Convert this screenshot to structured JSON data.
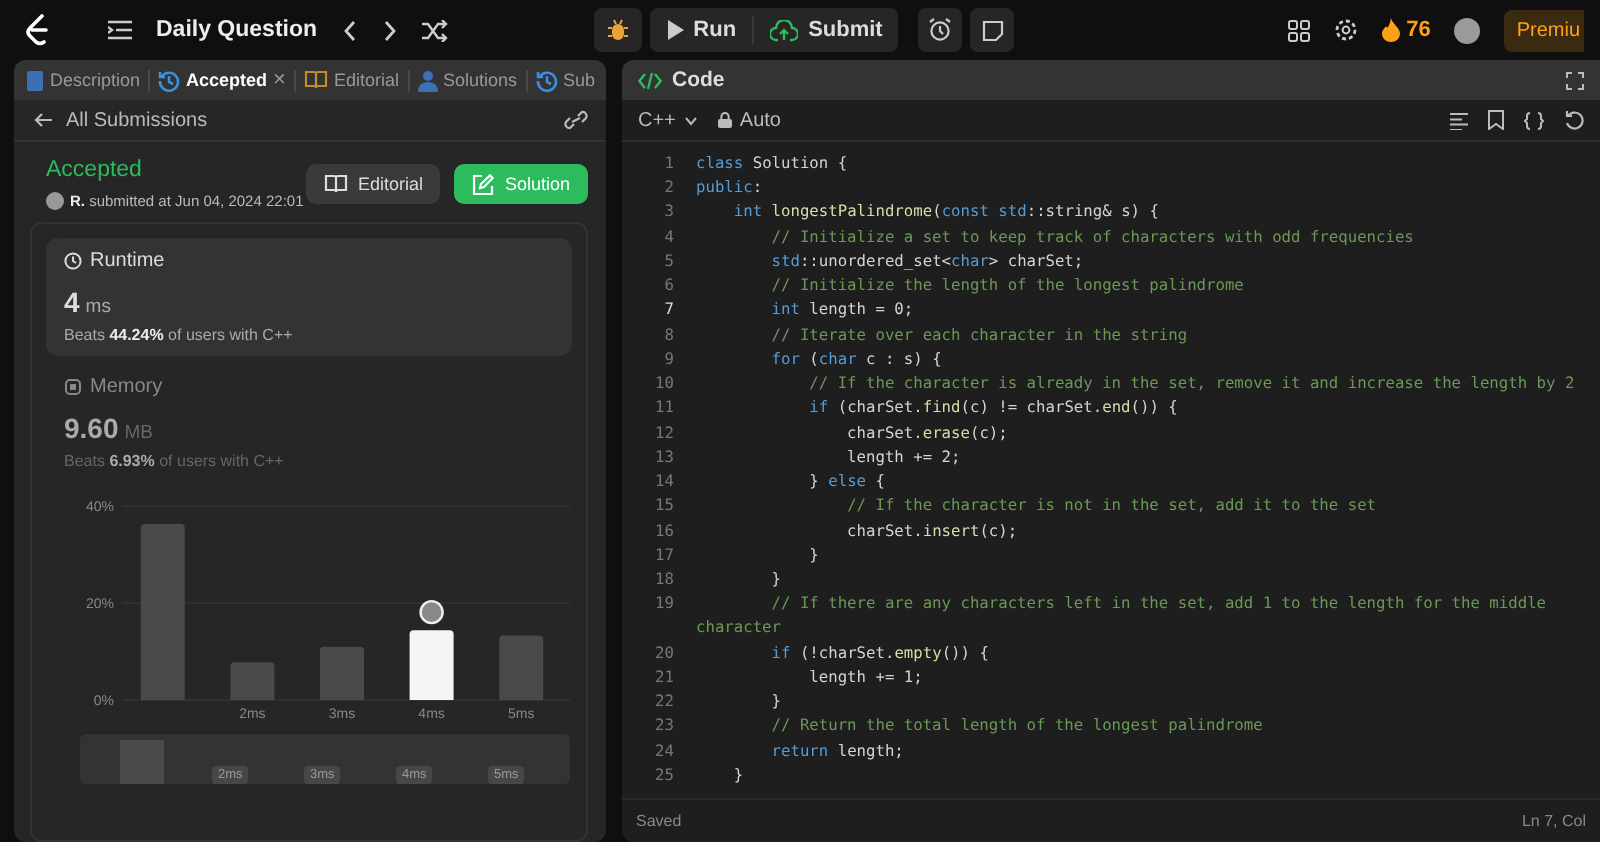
{
  "top_bar": {
    "title": "Daily Question",
    "run": "Run",
    "submit": "Submit",
    "streak": "76",
    "premium": "Premiu"
  },
  "left_panel": {
    "tabs": [
      {
        "label": "Description",
        "kind": "description",
        "selected": false
      },
      {
        "label": "Accepted",
        "kind": "history",
        "selected": true,
        "close_symbol": "×"
      },
      {
        "label": "Editorial",
        "kind": "book",
        "selected": false
      },
      {
        "label": "Solutions",
        "kind": "person",
        "selected": false
      },
      {
        "label": "Sub",
        "kind": "history",
        "selected": false
      }
    ],
    "back_link": "All Submissions",
    "result": {
      "status": "Accepted",
      "user": "R.",
      "submitted": "submitted at Jun 04, 2024 22:01",
      "editorial_button": "Editorial",
      "solution_button": "Solution"
    },
    "metrics": [
      {
        "kind": "runtime",
        "title": "Runtime",
        "value": "4",
        "unit": "ms",
        "beats": "Beats **44.24%** of users with C++",
        "selected": true
      },
      {
        "kind": "memory",
        "title": "Memory",
        "value": "9.60",
        "unit": "MB",
        "beats": "Beats **6.93%** of users with C++",
        "selected": false
      }
    ],
    "chart_data": {
      "type": "bar",
      "categories": [
        null,
        "2ms",
        "3ms",
        "4ms",
        "5ms"
      ],
      "values": [
        36.3,
        7.8,
        11,
        14.4,
        13.3
      ],
      "ylim": [
        0,
        40
      ],
      "yticks": [
        {
          "value": 0,
          "label": "0%"
        },
        {
          "value": 20,
          "label": "20%"
        },
        {
          "value": 40,
          "label": "40%"
        }
      ],
      "annotations": [
        {
          "x": "4ms"
        }
      ]
    },
    "overview_labels": [
      "2ms",
      "3ms",
      "4ms",
      "5ms"
    ]
  },
  "code_panel": {
    "title": "Code",
    "language": "C++",
    "mode": "Auto",
    "status": "Saved",
    "cursor": "Ln 7, Col",
    "lines": [
      {
        "number": "1",
        "text": "class Solution {"
      },
      {
        "number": "2",
        "text": "public:"
      },
      {
        "number": "3",
        "text": "    int longestPalindrome(const std::string& s) {"
      },
      {
        "number": "4",
        "text": "        // Initialize a set to keep track of characters with odd frequencies"
      },
      {
        "number": "5",
        "text": "        std::unordered_set<char> charSet;"
      },
      {
        "number": "6",
        "text": "        // Initialize the length of the longest palindrome"
      },
      {
        "number": "7",
        "text": "        int length = 0;"
      },
      {
        "number": "8",
        "text": "        // Iterate over each character in the string"
      },
      {
        "number": "9",
        "text": "        for (char c : s) {"
      },
      {
        "number": "10",
        "text": "            // If the character is already in the set, remove it and increase the length by 2"
      },
      {
        "number": "11",
        "text": "            if (charSet.find(c) != charSet.end()) {"
      },
      {
        "number": "12",
        "text": "                charSet.erase(c);"
      },
      {
        "number": "13",
        "text": "                length += 2;"
      },
      {
        "number": "14",
        "text": "            } else {"
      },
      {
        "number": "15",
        "text": "                // If the character is not in the set, add it to the set"
      },
      {
        "number": "16",
        "text": "                charSet.insert(c);"
      },
      {
        "number": "17",
        "text": "            }"
      },
      {
        "number": "18",
        "text": "        }"
      },
      {
        "number": "19",
        "text": "        // If there are any characters left in the set, add 1 to the length for the middle",
        "wrapped_text": "character"
      },
      {
        "number": "20",
        "text": "        if (!charSet.empty()) {"
      },
      {
        "number": "21",
        "text": "            length += 1;"
      },
      {
        "number": "22",
        "text": "        }"
      },
      {
        "number": "23",
        "text": "        // Return the total length of the longest palindrome"
      },
      {
        "number": "24",
        "text": "        return length;"
      },
      {
        "number": "25",
        "text": "    }"
      }
    ]
  }
}
